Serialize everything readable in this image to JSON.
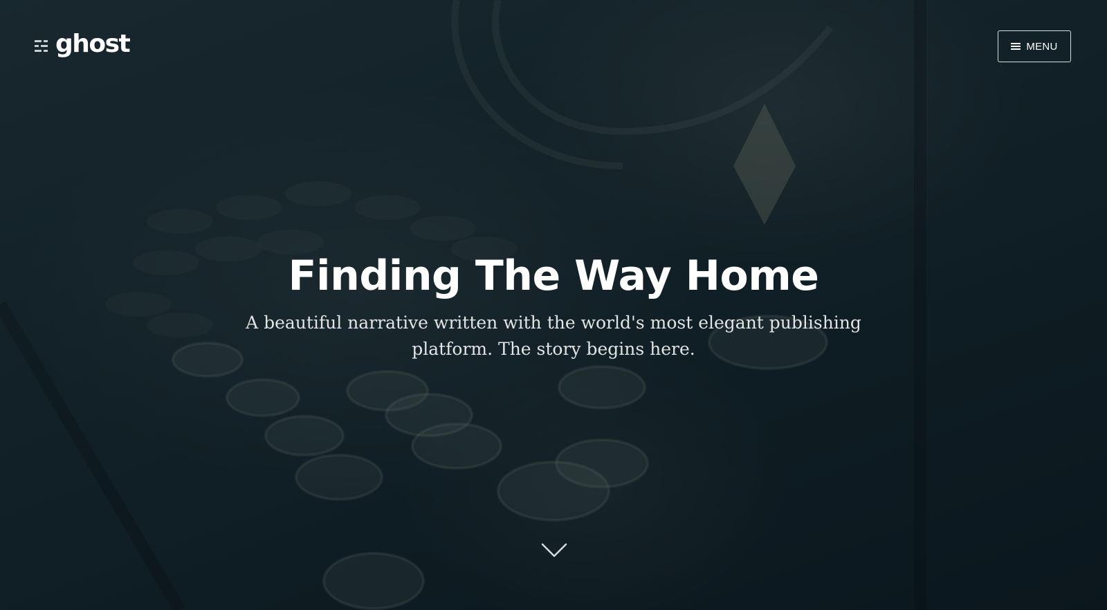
{
  "header": {
    "logo_text": "ghost",
    "logo_icon": "ghost-logo-icon",
    "menu_label": "MENU",
    "menu_icon": "hamburger-icon"
  },
  "hero": {
    "title": "Finding The Way Home",
    "description": "A beautiful narrative written with the world's most elegant publishing platform. The story begins here.",
    "scroll_icon": "chevron-down-icon",
    "background_subject": "typewriter-image"
  },
  "colors": {
    "overlay": "#0f1d24",
    "text": "#ffffff"
  }
}
